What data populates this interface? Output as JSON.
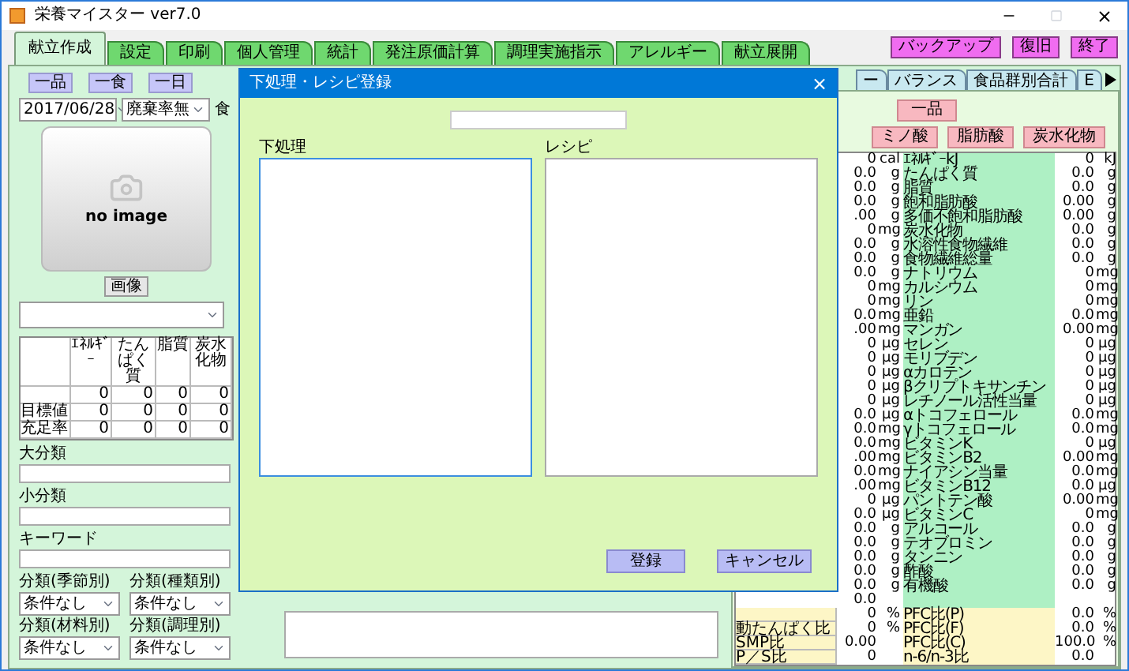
{
  "window": {
    "title": "栄養マイスター ver7.0"
  },
  "main_tabs": [
    {
      "label": "献立作成",
      "selected": true
    },
    {
      "label": "設定",
      "selected": false
    },
    {
      "label": "印刷",
      "selected": false
    },
    {
      "label": "個人管理",
      "selected": false
    },
    {
      "label": "統計",
      "selected": false
    },
    {
      "label": "発注原価計算",
      "selected": false
    },
    {
      "label": "調理実施指示",
      "selected": false
    },
    {
      "label": "アレルギー",
      "selected": false
    },
    {
      "label": "献立展開",
      "selected": false
    }
  ],
  "top_buttons": [
    "バックアップ",
    "復旧",
    "終了"
  ],
  "left": {
    "mode_buttons": [
      "一品",
      "一食",
      "一日"
    ],
    "date": "2017/06/28",
    "waste_select": "廃棄率無",
    "cut_label": "食",
    "image_text": "no image",
    "image_button": "画像",
    "table": {
      "columns": [
        "",
        "ｴﾈﾙｷﾞｰ",
        "たんぱく質",
        "脂質",
        "炭水化物"
      ],
      "rows": [
        [
          "",
          "0",
          "0",
          "0",
          "0"
        ],
        [
          "目標値",
          "0",
          "0",
          "0",
          "0"
        ],
        [
          "充足率",
          "0",
          "0",
          "0",
          "0"
        ]
      ]
    },
    "fields": [
      {
        "label": "大分類"
      },
      {
        "label": "小分類"
      },
      {
        "label": "キーワード"
      }
    ],
    "filters": [
      {
        "label": "分類(季節別)",
        "value": "条件なし"
      },
      {
        "label": "分類(種類別)",
        "value": "条件なし"
      },
      {
        "label": "分類(材料別)",
        "value": "条件なし"
      },
      {
        "label": "分類(調理別)",
        "value": "条件なし"
      }
    ]
  },
  "dialog": {
    "title": "下処理・レシピ登録",
    "close": "×",
    "left_label": "下処理",
    "right_label": "レシピ",
    "buttons": [
      "登録",
      "キャンセル"
    ]
  },
  "nutrient_panel": {
    "tabs": [
      {
        "label": "ー",
        "selected": false
      },
      {
        "label": "バランス",
        "selected": false
      },
      {
        "label": "食品群別合計",
        "selected": false
      },
      {
        "label": "E",
        "selected": false
      }
    ],
    "item_button": "一品",
    "category_buttons": [
      "ミノ酸",
      "脂肪酸",
      "炭水化物"
    ],
    "rows": [
      {
        "kind": "nutrient",
        "value": "0",
        "unit": "cal",
        "label": "ｴﾈﾙｷﾞｰkJ",
        "value_2": "0",
        "unit_2": "kJ"
      },
      {
        "kind": "nutrient",
        "value": "0.0",
        "unit": "g",
        "label": "たんぱく質",
        "value_2": "0.0",
        "unit_2": "g"
      },
      {
        "kind": "nutrient",
        "value": "0.0",
        "unit": "g",
        "label": "脂質",
        "value_2": "0.0",
        "unit_2": "g"
      },
      {
        "kind": "nutrient",
        "value": "0.0",
        "unit": "g",
        "label": "飽和脂肪酸",
        "value_2": "0.00",
        "unit_2": "g"
      },
      {
        "kind": "nutrient",
        "value": ".00",
        "unit": "g",
        "label": "多価不飽和脂肪酸",
        "value_2": "0.00",
        "unit_2": "g"
      },
      {
        "kind": "nutrient",
        "value": "0",
        "unit": "mg",
        "label": "炭水化物",
        "value_2": "0.0",
        "unit_2": "g"
      },
      {
        "kind": "nutrient",
        "value": "0.0",
        "unit": "g",
        "label": "水溶性食物繊維",
        "value_2": "0.0",
        "unit_2": "g"
      },
      {
        "kind": "nutrient",
        "value": "0.0",
        "unit": "g",
        "label": "食物繊維総量",
        "value_2": "0.0",
        "unit_2": "g"
      },
      {
        "kind": "nutrient",
        "value": "0.0",
        "unit": "g",
        "label": "ナトリウム",
        "value_2": "0",
        "unit_2": "mg"
      },
      {
        "kind": "nutrient",
        "value": "0",
        "unit": "mg",
        "label": "カルシウム",
        "value_2": "0",
        "unit_2": "mg"
      },
      {
        "kind": "nutrient",
        "value": "0",
        "unit": "mg",
        "label": "リン",
        "value_2": "0",
        "unit_2": "mg"
      },
      {
        "kind": "nutrient",
        "value": "0.0",
        "unit": "mg",
        "label": "亜鉛",
        "value_2": "0.0",
        "unit_2": "mg"
      },
      {
        "kind": "nutrient",
        "value": ".00",
        "unit": "mg",
        "label": "マンガン",
        "value_2": "0.00",
        "unit_2": "mg"
      },
      {
        "kind": "nutrient",
        "value": "0",
        "unit": "μg",
        "label": "セレン",
        "value_2": "0",
        "unit_2": "μg"
      },
      {
        "kind": "nutrient",
        "value": "0",
        "unit": "μg",
        "label": "モリブデン",
        "value_2": "0",
        "unit_2": "μg"
      },
      {
        "kind": "nutrient",
        "value": "0",
        "unit": "μg",
        "label": "αカロテン",
        "value_2": "0",
        "unit_2": "μg"
      },
      {
        "kind": "nutrient",
        "value": "0",
        "unit": "μg",
        "label": "βクリプトキサンチン",
        "value_2": "0",
        "unit_2": "μg"
      },
      {
        "kind": "nutrient",
        "value": "0",
        "unit": "μg",
        "label": "レチノール活性当量",
        "value_2": "0",
        "unit_2": "μg"
      },
      {
        "kind": "nutrient",
        "value": "0.0",
        "unit": "μg",
        "label": "αトコフェロール",
        "value_2": "0.0",
        "unit_2": "mg"
      },
      {
        "kind": "nutrient",
        "value": "0.0",
        "unit": "mg",
        "label": "γトコフェロール",
        "value_2": "0.0",
        "unit_2": "mg"
      },
      {
        "kind": "nutrient",
        "value": "0.0",
        "unit": "mg",
        "label": "ビタミンK",
        "value_2": "0",
        "unit_2": "μg"
      },
      {
        "kind": "nutrient",
        "value": ".00",
        "unit": "mg",
        "label": "ビタミンB2",
        "value_2": "0.00",
        "unit_2": "mg"
      },
      {
        "kind": "nutrient",
        "value": "0.0",
        "unit": "mg",
        "label": "ナイアシン当量",
        "value_2": "0.0",
        "unit_2": "mg"
      },
      {
        "kind": "nutrient",
        "value": ".00",
        "unit": "mg",
        "label": "ビタミンB12",
        "value_2": "0.0",
        "unit_2": "μg"
      },
      {
        "kind": "nutrient",
        "value": "0",
        "unit": "μg",
        "label": "パントテン酸",
        "value_2": "0.00",
        "unit_2": "mg"
      },
      {
        "kind": "nutrient",
        "value": "0.0",
        "unit": "μg",
        "label": "ビタミンC",
        "value_2": "0",
        "unit_2": "mg"
      },
      {
        "kind": "nutrient",
        "value": "0.0",
        "unit": "g",
        "label": "アルコール",
        "value_2": "0.0",
        "unit_2": "g"
      },
      {
        "kind": "nutrient",
        "value": "0.0",
        "unit": "g",
        "label": "テオブロミン",
        "value_2": "0.0",
        "unit_2": "g"
      },
      {
        "kind": "nutrient",
        "value": "0.0",
        "unit": "g",
        "label": "タンニン",
        "value_2": "0.0",
        "unit_2": "g"
      },
      {
        "kind": "nutrient",
        "value": "0.0",
        "unit": "g",
        "label": "酢酸",
        "value_2": "0.0",
        "unit_2": "g"
      },
      {
        "kind": "nutrient",
        "value": "0.0",
        "unit": "g",
        "label": "有機酸",
        "value_2": "0.0",
        "unit_2": "g"
      },
      {
        "kind": "nutrient",
        "value": "0.0"
      },
      {
        "kind": "ratio",
        "value": "0",
        "unit": "%",
        "label": "PFC比(P)",
        "value_2": "0.0",
        "unit_2": "%"
      },
      {
        "kind": "ratio",
        "left_label": "動たんぱく比",
        "value": "0",
        "unit": "%",
        "label": "PFC比(F)",
        "value_2": "0.0",
        "unit_2": "%"
      },
      {
        "kind": "ratio",
        "left_label": "SMP比",
        "value": "0.00",
        "label": "PFC比(C)",
        "value_2": "100.0",
        "unit_2": "%"
      },
      {
        "kind": "ratio",
        "left_label": "P／S比",
        "value": "0",
        "label": "n-6/n-3比",
        "value_2": "0.0"
      }
    ]
  }
}
